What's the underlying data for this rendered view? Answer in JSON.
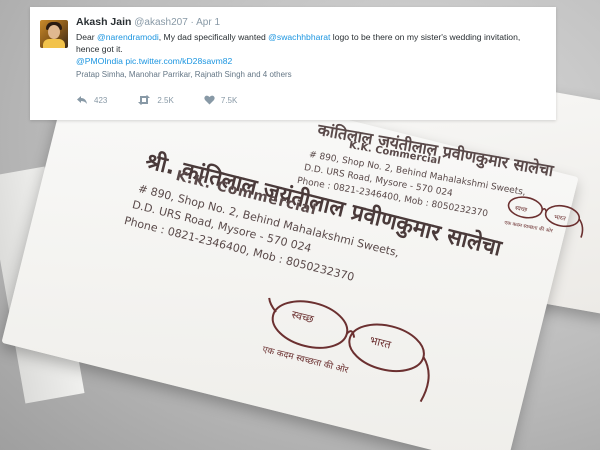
{
  "tweet": {
    "author_name": "Akash Jain",
    "handle": "@akash207",
    "separator": "·",
    "date": "Apr 1",
    "body_prefix": "Dear ",
    "mention_1": "@narendramodi",
    "body_mid": ", My dad specifically wanted ",
    "mention_2": "@swachhbharat",
    "body_suffix": " logo to be there on my sister's wedding invitation, hence got it.",
    "mention_3": "@PMOIndia",
    "pic_link": "pic.twitter.com/kD28savm82",
    "mentioned_users": "Pratap Simha, Manohar Parrikar, Rajnath Singh and 4 others",
    "reply_count": "423",
    "retweet_count": "2.5K",
    "like_count": "7.5K",
    "reply_icon": "reply-icon",
    "retweet_icon": "retweet-icon",
    "like_icon": "heart-icon",
    "link_color": "#1b95e0"
  },
  "card_front": {
    "title": "श्री. कांतिलाल जयंतीलाल प्रवीणकुमार सालेचा",
    "company": "K.K. Commercial",
    "address_1": "# 890, Shop No. 2, Behind Mahalakshmi Sweets,",
    "address_2": "D.D. URS Road, Mysore - 570 024",
    "phone": "Phone : 0821-2346400, Mob : 8050232370",
    "logo_left_text": "स्वच्छ",
    "logo_right_text": "भारत",
    "logo_tagline": "एक कदम स्वच्छता की ओर"
  },
  "card_back": {
    "title": "कांतिलाल जयंतीलाल प्रवीणकुमार सालेचा",
    "company": "K.K. Commercial",
    "address_1": "# 890, Shop No. 2, Behind Mahalakshmi Sweets,",
    "address_2": "D.D. URS Road, Mysore - 570 024",
    "phone": "Phone : 0821-2346400, Mob : 8050232370",
    "logo_left_text": "स्वच्छ",
    "logo_right_text": "भारत",
    "logo_tagline": "एक कदम स्वच्छता की ओर"
  }
}
